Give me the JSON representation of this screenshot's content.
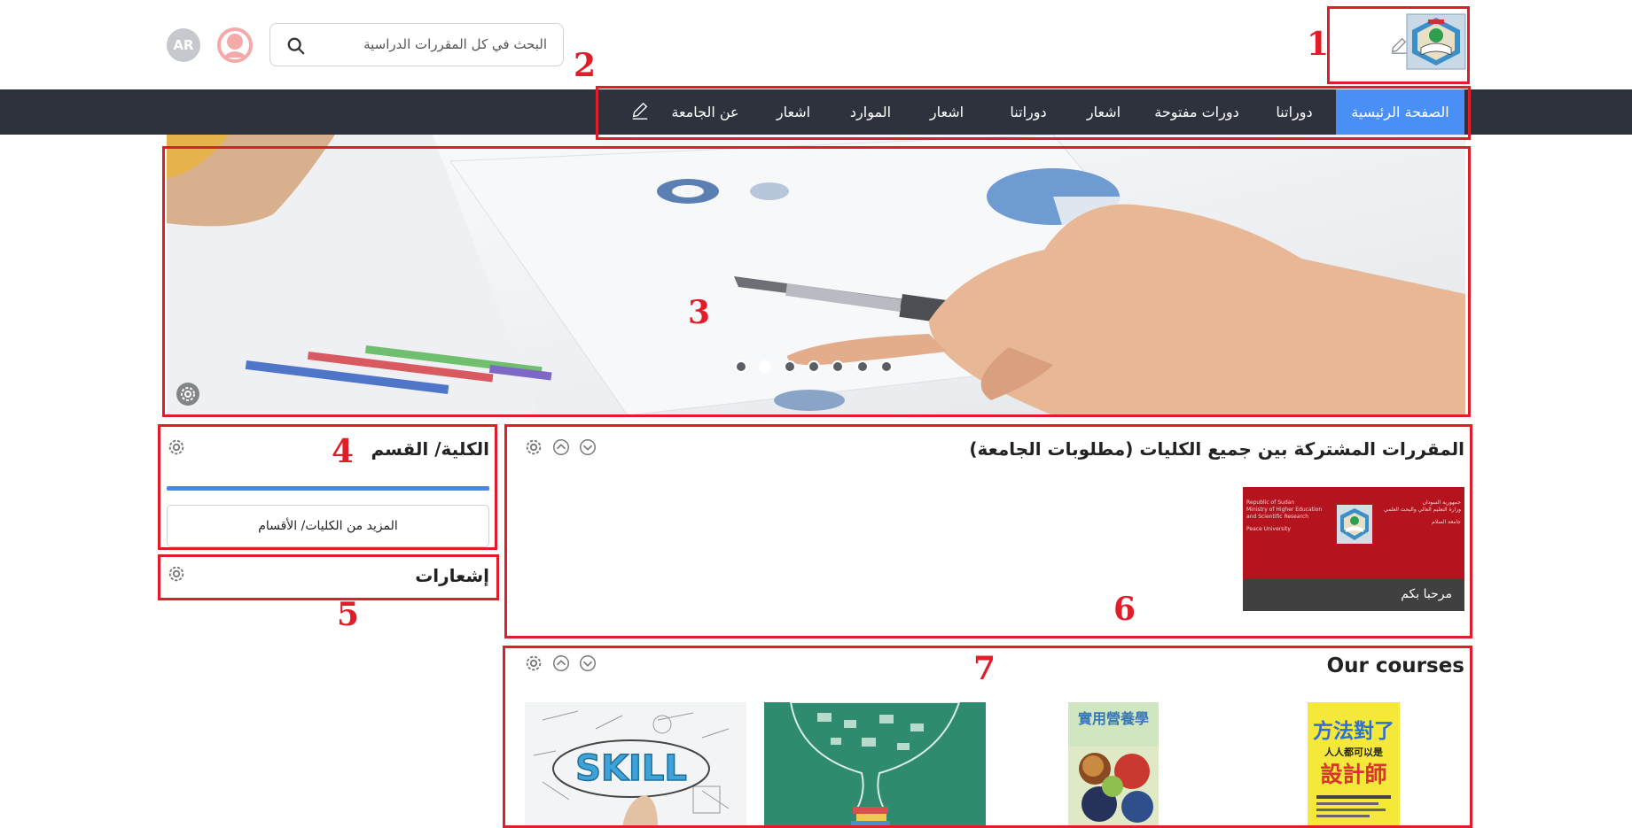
{
  "header": {
    "search_placeholder": "البحث في كل المقررات الدراسية",
    "language_badge": "AR"
  },
  "nav": {
    "items": [
      {
        "label": "الصفحة الرئيسية",
        "active": true
      },
      {
        "label": "دوراتنا"
      },
      {
        "label": "دورات مفتوحة"
      },
      {
        "label": "اشعار"
      },
      {
        "label": "دوراتنا"
      },
      {
        "label": "اشعار"
      },
      {
        "label": "الموارد"
      },
      {
        "label": "اشعار"
      },
      {
        "label": "عن الجامعة"
      }
    ]
  },
  "slider": {
    "slide_count": 7,
    "active_slide": 2
  },
  "faculty_block": {
    "title": "الكلية/ القسم",
    "more_button": "المزيد من الكليات/ الأقسام"
  },
  "notifications_block": {
    "title": "إشعارات"
  },
  "shared_courses": {
    "title": "المقررات المشتركة بين جميع الكليات (مطلوبات الجامعة)",
    "course": {
      "label": "مرحبا بكم",
      "image_text_left": [
        "Republic of Sudan",
        "Ministry of Higher Education",
        "and Scientific Research",
        "",
        "Peace University"
      ],
      "image_text_right": [
        "جمهورية السودان",
        "وزارة التعليم العالي والبحث العلمي",
        "",
        "جامعة السلام"
      ]
    }
  },
  "our_courses": {
    "title": "Our courses",
    "thumb_texts": {
      "skill": "SKILL",
      "book1": "實用營養學",
      "book2_top": "方法對了",
      "book2_mid": "人人都可以是",
      "book2_bot": "設計師"
    }
  },
  "annotations": [
    "1",
    "2",
    "3",
    "4",
    "5",
    "6",
    "7"
  ],
  "colors": {
    "annotation_red": "#e21d2a",
    "nav_bg": "#2d323d",
    "nav_active": "#4a8ff5",
    "progress": "#4a86e8",
    "course_red": "#b5141f"
  }
}
